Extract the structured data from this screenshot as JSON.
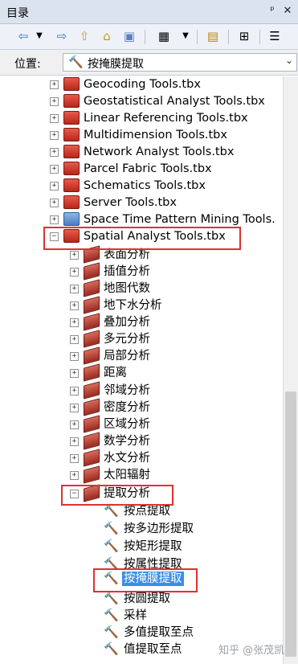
{
  "panel": {
    "title": "目录",
    "pin_glyph": "ᵖ",
    "close_glyph": "✕"
  },
  "toolbar": {
    "icons": [
      "back-arrow-icon",
      "dropdown-icon",
      "forward-arrow-icon",
      "up-folder-icon",
      "home-icon",
      "connect-folder-icon",
      "view-options-icon",
      "view-dropdown-icon",
      "new-toolbox-icon",
      "tree-view-icon",
      "details-icon"
    ]
  },
  "location": {
    "label": "位置:",
    "value": "按掩膜提取"
  },
  "tree": {
    "toolboxes": [
      {
        "label": "Geocoding Tools.tbx"
      },
      {
        "label": "Geostatistical Analyst Tools.tbx"
      },
      {
        "label": "Linear Referencing Tools.tbx"
      },
      {
        "label": "Multidimension Tools.tbx"
      },
      {
        "label": "Network Analyst Tools.tbx"
      },
      {
        "label": "Parcel Fabric Tools.tbx"
      },
      {
        "label": "Schematics Tools.tbx"
      },
      {
        "label": "Server Tools.tbx"
      },
      {
        "label": "Space Time Pattern Mining Tools."
      },
      {
        "label": "Spatial Analyst Tools.tbx"
      }
    ],
    "toolsets": [
      {
        "label": "表面分析"
      },
      {
        "label": "插值分析"
      },
      {
        "label": "地图代数"
      },
      {
        "label": "地下水分析"
      },
      {
        "label": "叠加分析"
      },
      {
        "label": "多元分析"
      },
      {
        "label": "局部分析"
      },
      {
        "label": "距离"
      },
      {
        "label": "邻域分析"
      },
      {
        "label": "密度分析"
      },
      {
        "label": "区域分析"
      },
      {
        "label": "数学分析"
      },
      {
        "label": "水文分析"
      },
      {
        "label": "太阳辐射"
      },
      {
        "label": "提取分析"
      }
    ],
    "tools": [
      {
        "label": "按点提取"
      },
      {
        "label": "按多边形提取"
      },
      {
        "label": "按矩形提取"
      },
      {
        "label": "按属性提取"
      },
      {
        "label": "按掩膜提取"
      },
      {
        "label": "按圆提取"
      },
      {
        "label": "采样"
      },
      {
        "label": "多值提取至点"
      },
      {
        "label": "值提取至点"
      }
    ]
  },
  "watermark": "知乎 @张茂凯",
  "colors": {
    "highlight_box": "#e03131",
    "selection": "#3b8ee6",
    "toolbox_red": "#c0392b"
  }
}
